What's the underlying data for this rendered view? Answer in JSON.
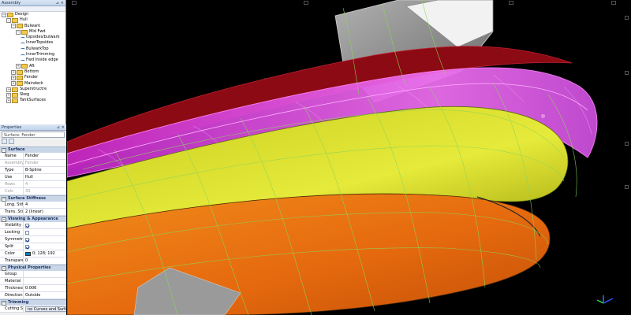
{
  "assembly_panel": {
    "title": "Assembly",
    "tree": [
      {
        "label": "Design",
        "level": 0,
        "expander": "−",
        "kind": "folder"
      },
      {
        "label": "Hull",
        "level": 1,
        "expander": "−",
        "kind": "folder"
      },
      {
        "label": "Bulwark",
        "level": 2,
        "expander": "−",
        "kind": "folder"
      },
      {
        "label": "Mid Fwd",
        "level": 3,
        "expander": "−",
        "kind": "folder"
      },
      {
        "label": "topsides/bulwark",
        "level": 4,
        "expander": "",
        "kind": "curve"
      },
      {
        "label": "InnerTopsides",
        "level": 4,
        "expander": "",
        "kind": "curve"
      },
      {
        "label": "BulwarkTop",
        "level": 4,
        "expander": "",
        "kind": "curve"
      },
      {
        "label": "InnerTrimming",
        "level": 4,
        "expander": "",
        "kind": "curve"
      },
      {
        "label": "Fwd Inside edge",
        "level": 4,
        "expander": "",
        "kind": "curve"
      },
      {
        "label": "Aft",
        "level": 3,
        "expander": "+",
        "kind": "folder"
      },
      {
        "label": "Bottom",
        "level": 2,
        "expander": "+",
        "kind": "folder"
      },
      {
        "label": "Fender",
        "level": 2,
        "expander": "+",
        "kind": "folder"
      },
      {
        "label": "Maindeck",
        "level": 2,
        "expander": "+",
        "kind": "folder"
      },
      {
        "label": "Superstructre",
        "level": 1,
        "expander": "+",
        "kind": "folder"
      },
      {
        "label": "Skeg",
        "level": 1,
        "expander": "+",
        "kind": "folder"
      },
      {
        "label": "TankSurfaces",
        "level": 1,
        "expander": "+",
        "kind": "folder"
      }
    ]
  },
  "properties_panel": {
    "title": "Properties",
    "selected_object": "Surface: Fender",
    "sections": [
      {
        "title": "Surface",
        "rows": [
          {
            "key": "Name",
            "value": "Fender",
            "type": "text"
          },
          {
            "key": "Assembly",
            "value": "Fender",
            "type": "text",
            "disabled": true
          },
          {
            "key": "Type",
            "value": "B-Spline",
            "type": "text"
          },
          {
            "key": "Use",
            "value": "Hull",
            "type": "text"
          },
          {
            "key": "Rows",
            "value": "4",
            "type": "text",
            "disabled": true
          },
          {
            "key": "Cols",
            "value": "33",
            "type": "text",
            "disabled": true
          }
        ]
      },
      {
        "title": "Surface Stiffness",
        "rows": [
          {
            "key": "Long. Stiff.",
            "value": "4",
            "type": "text"
          },
          {
            "key": "Trans. Stiff.",
            "value": "2 (linear)",
            "type": "text"
          }
        ]
      },
      {
        "title": "Viewing & Appearance",
        "rows": [
          {
            "key": "Visibility",
            "value": "",
            "type": "check",
            "checked": true
          },
          {
            "key": "Locking",
            "value": "",
            "type": "check",
            "checked": false
          },
          {
            "key": "Symmetry",
            "value": "",
            "type": "check",
            "checked": true
          },
          {
            "key": "Split",
            "value": "",
            "type": "check",
            "checked": true
          },
          {
            "key": "Color",
            "value": "0; 128; 192",
            "type": "color",
            "swatch": "#0080c0"
          },
          {
            "key": "Transparency %",
            "value": "0",
            "type": "text"
          }
        ]
      },
      {
        "title": "Physical Properties",
        "rows": [
          {
            "key": "Group",
            "value": "",
            "type": "text"
          },
          {
            "key": "Material",
            "value": "",
            "type": "text"
          },
          {
            "key": "Thickness m",
            "value": "0.006",
            "type": "text"
          },
          {
            "key": "Direction",
            "value": "Outside",
            "type": "text"
          }
        ]
      },
      {
        "title": "Trimming",
        "rows": [
          {
            "key": "Cutting Surfs",
            "value": "no Curves and Surfa",
            "type": "button"
          }
        ]
      }
    ]
  },
  "viewport": {
    "label": "3D model view",
    "colors": {
      "background": "#000000",
      "fender": "#e040e8",
      "topsides": "#d4d622",
      "bottom": "#e86a12",
      "bulwark": "#8c0a14",
      "superstructure": "#8a8a8a",
      "wireframe": "#8cd65a"
    }
  }
}
